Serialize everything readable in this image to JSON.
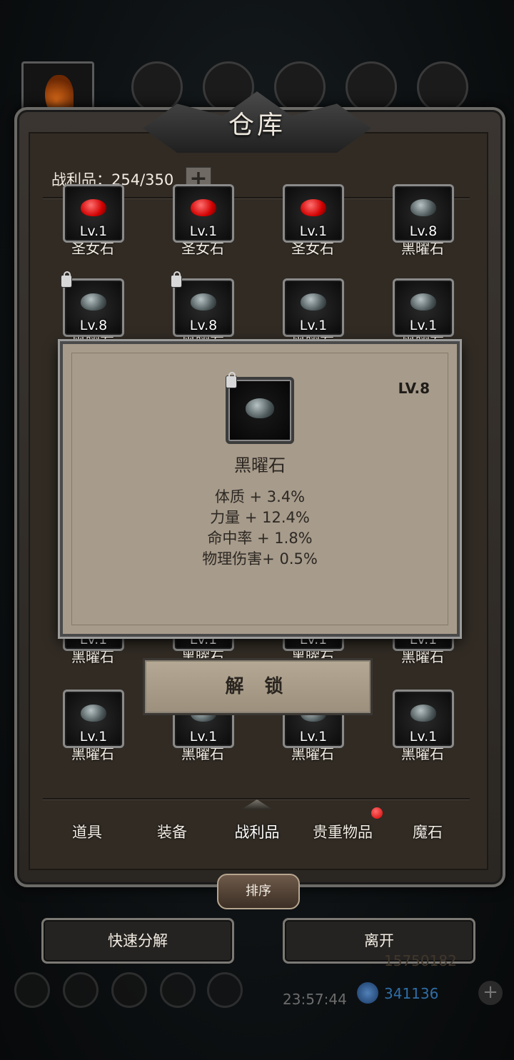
{
  "window": {
    "title": "仓库"
  },
  "loot_count": "战利品：254/350",
  "plus_label": "+",
  "grid_rows": [
    [
      {
        "lv": "Lv.1",
        "name": "圣女石",
        "gem": "red"
      },
      {
        "lv": "Lv.1",
        "name": "圣女石",
        "gem": "red"
      },
      {
        "lv": "Lv.1",
        "name": "圣女石",
        "gem": "red"
      },
      {
        "lv": "Lv.8",
        "name": "黑曜石",
        "gem": "grey"
      }
    ],
    [
      {
        "lv": "Lv.8",
        "name": "黑曜石",
        "gem": "grey",
        "locked": true
      },
      {
        "lv": "Lv.8",
        "name": "黑曜石",
        "gem": "grey",
        "locked": true
      },
      {
        "lv": "Lv.1",
        "name": "黑曜石",
        "gem": "grey"
      },
      {
        "lv": "Lv.1",
        "name": "黑曜石",
        "gem": "grey"
      }
    ],
    [
      {
        "lv": "Lv.1",
        "name": "黑曜石",
        "gem": "grey"
      },
      {
        "lv": "Lv.1",
        "name": "黑曜石",
        "gem": "grey"
      },
      {
        "lv": "Lv.1",
        "name": "黑曜石",
        "gem": "grey"
      },
      {
        "lv": "Lv.1",
        "name": "黑曜石",
        "gem": "grey"
      }
    ],
    [
      {
        "lv": "Lv.1",
        "name": "黑曜石",
        "gem": "grey"
      },
      {
        "lv": "Lv.1",
        "name": "黑曜石",
        "gem": "grey"
      },
      {
        "lv": "Lv.1",
        "name": "黑曜石",
        "gem": "grey"
      },
      {
        "lv": "Lv.1",
        "name": "黑曜石",
        "gem": "grey"
      }
    ]
  ],
  "popup": {
    "level": "LV.8",
    "name": "黑曜石",
    "stats": [
      "体质 + 3.4%",
      "力量 + 12.4%",
      "命中率 + 1.8%",
      "物理伤害+ 0.5%"
    ]
  },
  "unlock_label": "解 锁",
  "tabs": [
    "道具",
    "装备",
    "战利品",
    "贵重物品",
    "魔石"
  ],
  "active_tab": "战利品",
  "sort_label": "排序",
  "quick_decompose_label": "快速分解",
  "leave_label": "离开",
  "hud": {
    "time": "23:57:44",
    "crystals": "341136",
    "gold_partial": "15750182"
  },
  "colors": {
    "accent_red": "#d40000",
    "frame": "#6c6a66",
    "popup_bg": "#a79b8b"
  }
}
